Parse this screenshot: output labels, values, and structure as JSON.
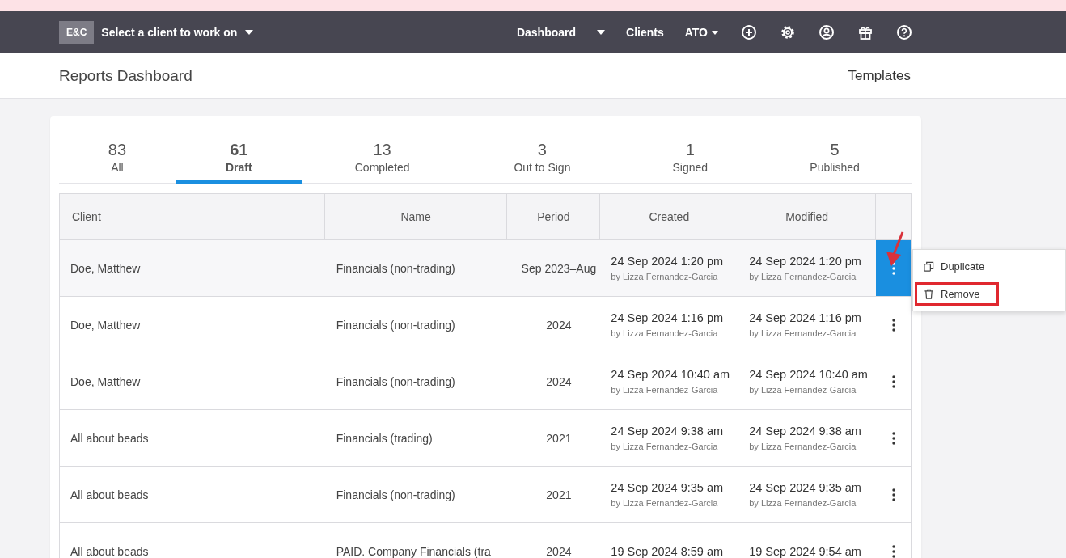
{
  "topbar": {
    "badge": "E&C",
    "client_selector": "Select a client to work on",
    "nav": [
      {
        "label": "Dashboard",
        "kind": "split"
      },
      {
        "label": "Clients",
        "kind": "link"
      },
      {
        "label": "ATO",
        "kind": "dropdown"
      }
    ]
  },
  "header": {
    "title": "Reports Dashboard",
    "link": "Templates"
  },
  "tabs": [
    {
      "count": "83",
      "label": "All",
      "selected": false
    },
    {
      "count": "61",
      "label": "Draft",
      "selected": true
    },
    {
      "count": "13",
      "label": "Completed",
      "selected": false
    },
    {
      "count": "3",
      "label": "Out to Sign",
      "selected": false
    },
    {
      "count": "1",
      "label": "Signed",
      "selected": false
    },
    {
      "count": "5",
      "label": "Published",
      "selected": false
    }
  ],
  "table": {
    "columns": [
      "Client",
      "Name",
      "Period",
      "Created",
      "Modified"
    ],
    "rows": [
      {
        "client": "Doe, Matthew",
        "name": "Financials (non-trading)",
        "period": "Sep 2023–Aug",
        "created": "24 Sep 2024 1:20 pm",
        "created_by": "by Lizza Fernandez-Garcia",
        "modified": "24 Sep 2024 1:20 pm",
        "modified_by": "by Lizza Fernandez-Garcia",
        "menu_open": true
      },
      {
        "client": "Doe, Matthew",
        "name": "Financials (non-trading)",
        "period": "2024",
        "created": "24 Sep 2024 1:16 pm",
        "created_by": "by Lizza Fernandez-Garcia",
        "modified": "24 Sep 2024 1:16 pm",
        "modified_by": "by Lizza Fernandez-Garcia",
        "menu_open": false
      },
      {
        "client": "Doe, Matthew",
        "name": "Financials (non-trading)",
        "period": "2024",
        "created": "24 Sep 2024 10:40 am",
        "created_by": "by Lizza Fernandez-Garcia",
        "modified": "24 Sep 2024 10:40 am",
        "modified_by": "by Lizza Fernandez-Garcia",
        "menu_open": false
      },
      {
        "client": "All about beads",
        "name": "Financials (trading)",
        "period": "2021",
        "created": "24 Sep 2024 9:38 am",
        "created_by": "by Lizza Fernandez-Garcia",
        "modified": "24 Sep 2024 9:38 am",
        "modified_by": "by Lizza Fernandez-Garcia",
        "menu_open": false
      },
      {
        "client": "All about beads",
        "name": "Financials (non-trading)",
        "period": "2021",
        "created": "24 Sep 2024 9:35 am",
        "created_by": "by Lizza Fernandez-Garcia",
        "modified": "24 Sep 2024 9:35 am",
        "modified_by": "by Lizza Fernandez-Garcia",
        "menu_open": false
      },
      {
        "client": "All about beads",
        "name": "PAID. Company Financials (tra",
        "period": "2024",
        "created": "19 Sep 2024 8:59 am",
        "modified": "19 Sep 2024 9:54 am",
        "menu_open": false
      }
    ]
  },
  "row_menu": {
    "items": [
      {
        "label": "Duplicate",
        "kind": "duplicate",
        "highlighted": false
      },
      {
        "label": "Remove",
        "kind": "remove",
        "highlighted": true
      }
    ],
    "arrow_annotation": true
  }
}
